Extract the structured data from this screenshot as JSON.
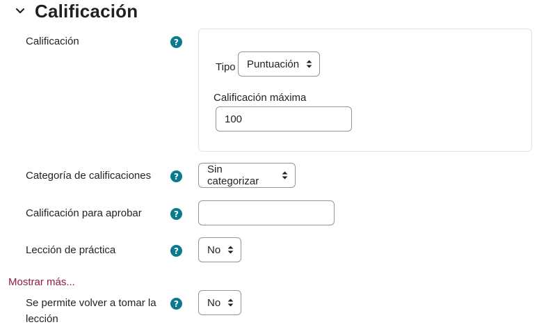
{
  "section": {
    "title": "Calificación",
    "toggle_icon": "chevron-down-icon"
  },
  "grade": {
    "label": "Calificación",
    "type_label": "Tipo",
    "type_value": "Puntuación",
    "max_label": "Calificación máxima",
    "max_value": "100"
  },
  "category": {
    "label": "Categoría de calificaciones",
    "value": "Sin categorizar"
  },
  "pass": {
    "label": "Calificación para aprobar",
    "value": ""
  },
  "practice": {
    "label": "Lección de práctica",
    "value": "No"
  },
  "show_more": "Mostrar más...",
  "retake": {
    "label_line1": "Se permite volver a tomar la",
    "label_line2": "lección",
    "value": "No"
  },
  "help_glyph": "?",
  "colors": {
    "help_icon": "#0b7a8c",
    "link": "#8e1b3c",
    "border": "#8f959e"
  }
}
